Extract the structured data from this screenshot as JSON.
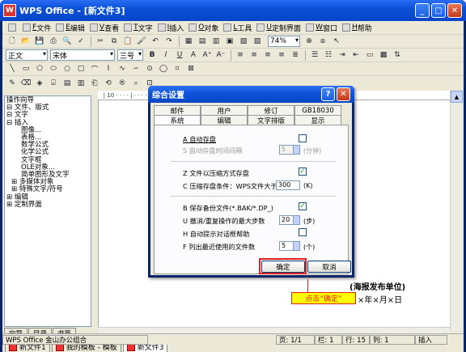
{
  "app": {
    "title": "WPS Office - [新文件3]",
    "icon": "W"
  },
  "menu": [
    "文件",
    "编辑",
    "查看",
    "文字",
    "插入",
    "对象",
    "工具",
    "定制界面",
    "窗口",
    "帮助"
  ],
  "menu_keys": [
    "F",
    "E",
    "V",
    "T",
    "I",
    "O",
    "L",
    "U",
    "W",
    "H"
  ],
  "toolbar": {
    "zoom": "74%"
  },
  "format": {
    "style": "正文",
    "font": "宋体",
    "size": "三号",
    "bold": "B",
    "italic": "I",
    "underline": "U"
  },
  "tree": [
    "操作向导",
    "⊟ 文件、版式",
    "⊟ 文字",
    "⊟ 插入",
    "图像...",
    "表格...",
    "数学公式",
    "化学公式",
    "文字框",
    "OLE对象...",
    "简单图形及文字",
    "⊞ 多媒体对象",
    "⊞ 特殊文字/符号",
    "⊞ 编辑",
    "⊞ 定制界面"
  ],
  "left_tabs": [
    "向导",
    "目录",
    "书签"
  ],
  "doc_tabs": [
    "新文件1",
    "我的模板 - 模板",
    "新文件3"
  ],
  "status": {
    "app": "WPS Office 金山办公组合",
    "page": "页: 1/1",
    "col": "栏: 1",
    "row": "行: 15",
    "column": "列: 1",
    "mode": "插入"
  },
  "dialog": {
    "title": "综合设置",
    "help": "?",
    "tabs_row1": [
      "邮件",
      "用户",
      "修订",
      "GB18030"
    ],
    "tabs_row2": [
      "系统",
      "编辑",
      "文字排版",
      "显示"
    ],
    "options": {
      "autosave": "A 自动存盘",
      "autosave_interval": "S 自动存盘时间间隔",
      "autosave_value": "5",
      "autosave_unit": "(分钟)",
      "compress": "Z 文件以压缩方式存盘",
      "compress_cond": "C 压缩存盘条件：WPS文件大于",
      "compress_value": "300",
      "compress_unit": "(K)",
      "backup": "B 保存备份文件(*.BAK/*.DP_)",
      "undo": "U 撤消/重复操作的最大步数",
      "undo_value": "20",
      "undo_unit": "(步)",
      "tips": "H 自动提示对话框帮助",
      "recent": "F 列出最近使用的文件数",
      "recent_value": "5",
      "recent_unit": "(个)"
    },
    "checks": {
      "autosave": false,
      "compress": true,
      "backup": true,
      "tips": false
    },
    "ok": "确定",
    "cancel": "取消"
  },
  "annotation": {
    "callout": "点击“确定”",
    "poster_line1": "(海报发布单位)",
    "poster_line2": "×年×月×日"
  }
}
